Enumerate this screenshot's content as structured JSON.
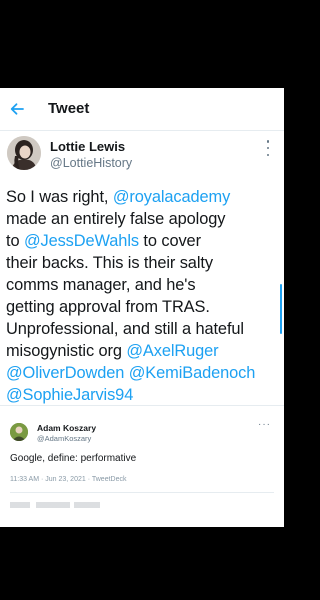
{
  "header": {
    "title": "Tweet",
    "back_icon": "arrow-left-icon"
  },
  "tweet": {
    "author_name": "Lottie Lewis",
    "author_handle": "@LottieHistory",
    "lines": [
      [
        {
          "t": "So I was right, "
        },
        {
          "t": "@royalacademy",
          "m": true
        }
      ],
      [
        {
          "t": "made an entirely false apology"
        }
      ],
      [
        {
          "t": "to "
        },
        {
          "t": "@JessDeWahls",
          "m": true
        },
        {
          "t": " to cover"
        }
      ],
      [
        {
          "t": "their backs. This is their salty"
        }
      ],
      [
        {
          "t": "comms manager, and he's"
        }
      ],
      [
        {
          "t": "getting approval from TRAS."
        }
      ],
      [
        {
          "t": "Unprofessional, and still a hateful"
        }
      ],
      [
        {
          "t": "misogynistic org "
        },
        {
          "t": "@AxelRuger",
          "m": true
        }
      ],
      [
        {
          "t": "@OliverDowden",
          "m": true
        },
        {
          "t": " "
        },
        {
          "t": "@KemiBadenoch",
          "m": true
        }
      ],
      [
        {
          "t": "@SophieJarvis94",
          "m": true
        }
      ]
    ]
  },
  "quoted": {
    "author_name": "Adam Koszary",
    "author_handle": "@AdamKoszary",
    "text": "Google, define: performative",
    "meta": "11:33 AM · Jun 23, 2021 · TweetDeck",
    "more_label": "···"
  },
  "colors": {
    "accent": "#1da1f2",
    "text": "#14171a",
    "secondary": "#657786"
  }
}
